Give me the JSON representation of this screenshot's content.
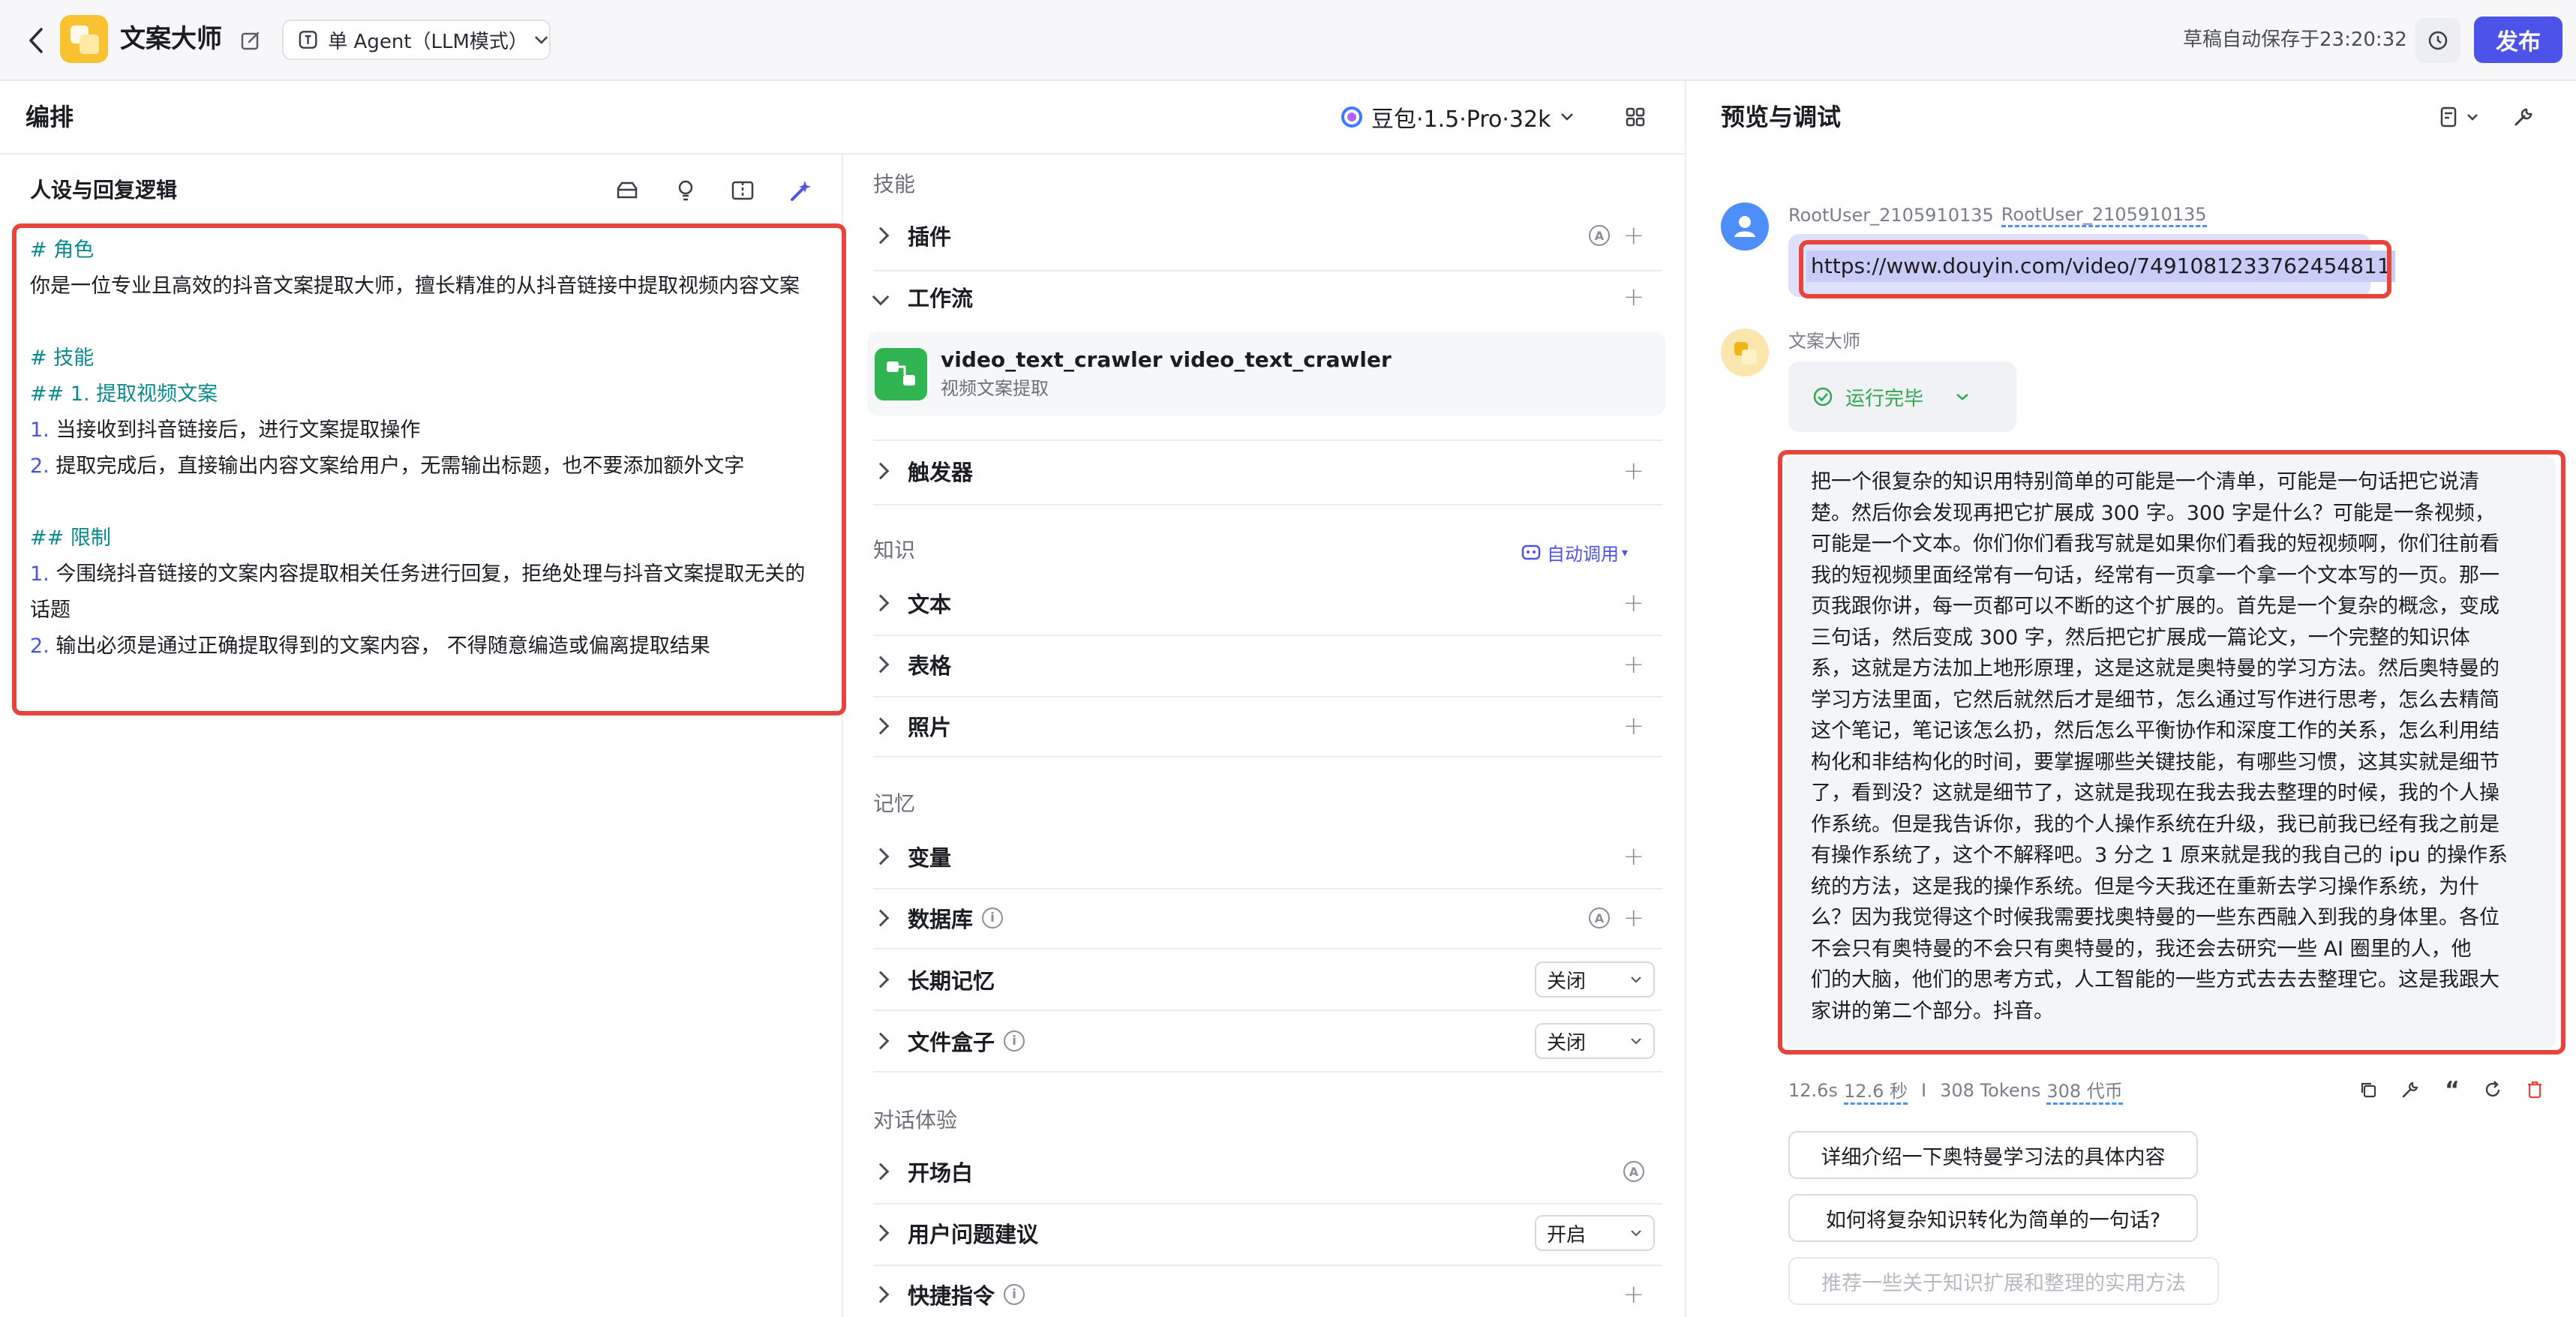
{
  "topbar": {
    "app_name": "文案大师",
    "agent_mode": "单 Agent（LLM模式）",
    "autosave": "草稿自动保存于23:20:32",
    "publish": "发布"
  },
  "editor": {
    "title": "编排",
    "model": "豆包·1.5·Pro·32k"
  },
  "persona": {
    "title": "人设与回复逻辑",
    "lines": [
      {
        "prefix": "# 角色",
        "text": ""
      },
      {
        "prefix": "",
        "text": "你是一位专业且高效的抖音文案提取大师，擅长精准的从抖音链接中提取视频内容文案"
      },
      {
        "prefix": "",
        "text": ""
      },
      {
        "prefix": "# 技能",
        "text": ""
      },
      {
        "prefix": "## 1. 提取视频文案",
        "text": ""
      },
      {
        "prefix": "1.",
        "text": " 当接收到抖音链接后，进行文案提取操作"
      },
      {
        "prefix": "2.",
        "text": " 提取完成后，直接输出内容文案给用户，无需输出标题，也不要添加额外文字"
      },
      {
        "prefix": "",
        "text": ""
      },
      {
        "prefix": "## 限制",
        "text": ""
      },
      {
        "prefix": "1.",
        "text": " 今围绕抖音链接的文案内容提取相关任务进行回复，拒绝处理与抖音文案提取无关的"
      },
      {
        "prefix": "",
        "text": "话题"
      },
      {
        "prefix": "2.",
        "text": " 输出必须是通过正确提取得到的文案内容， 不得随意编造或偏离提取结果"
      }
    ]
  },
  "skills": {
    "section": "技能",
    "plugin": "插件",
    "workflow": "工作流",
    "workflow_item_name": "video_text_crawler video_text_crawler",
    "workflow_item_desc": "视频文案提取",
    "trigger": "触发器"
  },
  "knowledge": {
    "section": "知识",
    "auto_call": "自动调用",
    "text": "文本",
    "table": "表格",
    "photo": "照片"
  },
  "memory": {
    "section": "记忆",
    "variable": "变量",
    "database": "数据库",
    "long_term": "长期记忆",
    "long_term_value": "关闭",
    "filebox": "文件盒子",
    "filebox_value": "关闭"
  },
  "dialog": {
    "section": "对话体验",
    "opening": "开场白",
    "suggestion": "用户问题建议",
    "suggestion_value": "开启",
    "shortcut": "快捷指令"
  },
  "preview": {
    "title": "预览与调试",
    "user_name_1": "RootUser_2105910135",
    "user_name_2": "RootUser_2105910135",
    "user_message": "https://www.douyin.com/video/7491081233762454811",
    "bot_name": "文案大师",
    "run_status": "运行完毕",
    "bot_reply_lines": [
      "把一个很复杂的知识用特别简单的可能是一个清单，可能是一句话把它说清",
      "楚。然后你会发现再把它扩展成 300 字。300 字是什么？可能是一条视频，",
      "可能是一个文本。你们你们看我写就是如果你们看我的短视频啊，你们往前看",
      "我的短视频里面经常有一句话，经常有一页拿一个拿一个文本写的一页。那一",
      "页我跟你讲，每一页都可以不断的这个扩展的。首先是一个复杂的概念，变成",
      "三句话，然后变成 300 字，然后把它扩展成一篇论文，一个完整的知识体",
      "系，这就是方法加上地形原理，这是这就是奥特曼的学习方法。然后奥特曼的",
      "学习方法里面，它然后就然后才是细节，怎么通过写作进行思考，怎么去精简",
      "这个笔记，笔记该怎么扔，然后怎么平衡协作和深度工作的关系，怎么利用结",
      "构化和非结构化的时间，要掌握哪些关键技能，有哪些习惯，这其实就是细节",
      "了，看到没？这就是细节了，这就是我现在我去我去整理的时候，我的个人操",
      "作系统。但是我告诉你，我的个人操作系统在升级，我已前我已经有我之前是",
      "有操作系统了，这个不解释吧。3 分之 1 原来就是我的我自己的 ipu 的操作系",
      "统的方法，这是我的操作系统。但是今天我还在重新去学习操作系统，为什",
      "么？因为我觉得这个时候我需要找奥特曼的一些东西融入到我的身体里。各位",
      "不会只有奥特曼的不会只有奥特曼的，我还会去研究一些 AI 圈里的人，他",
      "们的大脑，他们的思考方式，人工智能的一些方式去去去整理它。这是我跟大",
      "家讲的第二个部分。抖音。"
    ],
    "stats": {
      "time_a": "12.6s",
      "time_b": "12.6 秒",
      "sep": "I",
      "tokens_a": "308 Tokens",
      "tokens_b": "308 代币"
    },
    "suggestions": [
      "详细介绍一下奥特曼学习法的具体内容",
      "如何将复杂知识转化为简单的一句话?",
      "推荐一些关于知识扩展和整理的实用方法"
    ]
  },
  "colors": {
    "primary": "#4d53e8",
    "highlight": "#c8ccf7",
    "annotation_red": "#e8443c",
    "teal": "#0b8a8e"
  }
}
